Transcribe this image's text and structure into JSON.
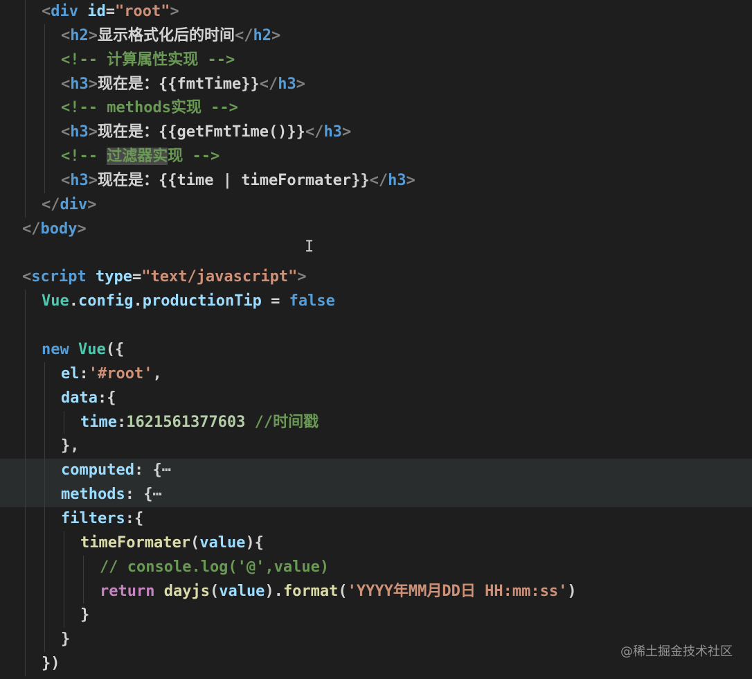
{
  "editor": {
    "colors": {
      "background": "#1e1e1e",
      "tag": "#569cd6",
      "attribute": "#9cdcfe",
      "string": "#ce9178",
      "comment": "#6a9955",
      "keyword": "#569cd6",
      "control": "#c586c0",
      "function": "#dcdcaa",
      "number": "#b5cea8",
      "text": "#d4d4d4"
    },
    "lines": [
      {
        "indent": 2,
        "guides": [
          1
        ],
        "tokens": [
          {
            "t": "<",
            "c": "#808080"
          },
          {
            "t": "div",
            "c": "#569cd6"
          },
          {
            "t": " id",
            "c": "#9cdcfe"
          },
          {
            "t": "=",
            "c": "#d4d4d4"
          },
          {
            "t": "\"root\"",
            "c": "#ce9178"
          },
          {
            "t": ">",
            "c": "#808080"
          }
        ]
      },
      {
        "indent": 3,
        "guides": [
          1,
          2
        ],
        "tokens": [
          {
            "t": "<",
            "c": "#808080"
          },
          {
            "t": "h2",
            "c": "#569cd6"
          },
          {
            "t": ">",
            "c": "#808080"
          },
          {
            "t": "显示格式化后的时间",
            "c": "#d4d4d4"
          },
          {
            "t": "</",
            "c": "#808080"
          },
          {
            "t": "h2",
            "c": "#569cd6"
          },
          {
            "t": ">",
            "c": "#808080"
          }
        ]
      },
      {
        "indent": 3,
        "guides": [
          1,
          2
        ],
        "tokens": [
          {
            "t": "<!-- 计算属性实现 -->",
            "c": "#6a9955"
          }
        ]
      },
      {
        "indent": 3,
        "guides": [
          1,
          2
        ],
        "tokens": [
          {
            "t": "<",
            "c": "#808080"
          },
          {
            "t": "h3",
            "c": "#569cd6"
          },
          {
            "t": ">",
            "c": "#808080"
          },
          {
            "t": "现在是：{{fmtTime}}",
            "c": "#d4d4d4"
          },
          {
            "t": "</",
            "c": "#808080"
          },
          {
            "t": "h3",
            "c": "#569cd6"
          },
          {
            "t": ">",
            "c": "#808080"
          }
        ]
      },
      {
        "indent": 3,
        "guides": [
          1,
          2
        ],
        "tokens": [
          {
            "t": "<!-- methods实现 -->",
            "c": "#6a9955"
          }
        ]
      },
      {
        "indent": 3,
        "guides": [
          1,
          2
        ],
        "tokens": [
          {
            "t": "<",
            "c": "#808080"
          },
          {
            "t": "h3",
            "c": "#569cd6"
          },
          {
            "t": ">",
            "c": "#808080"
          },
          {
            "t": "现在是：{{getFmtTime()}}",
            "c": "#d4d4d4"
          },
          {
            "t": "</",
            "c": "#808080"
          },
          {
            "t": "h3",
            "c": "#569cd6"
          },
          {
            "t": ">",
            "c": "#808080"
          }
        ]
      },
      {
        "indent": 3,
        "guides": [
          1,
          2
        ],
        "tokens": [
          {
            "t": "<!-- ",
            "c": "#6a9955"
          },
          {
            "t": "过滤器实",
            "c": "#6a9955",
            "sel": true
          },
          {
            "t": "现 -->",
            "c": "#6a9955"
          }
        ]
      },
      {
        "indent": 3,
        "guides": [
          1,
          2
        ],
        "tokens": [
          {
            "t": "<",
            "c": "#808080"
          },
          {
            "t": "h3",
            "c": "#569cd6"
          },
          {
            "t": ">",
            "c": "#808080"
          },
          {
            "t": "现在是：{{time | timeFormater}}",
            "c": "#d4d4d4"
          },
          {
            "t": "</",
            "c": "#808080"
          },
          {
            "t": "h3",
            "c": "#569cd6"
          },
          {
            "t": ">",
            "c": "#808080"
          }
        ]
      },
      {
        "indent": 2,
        "guides": [
          1
        ],
        "tokens": [
          {
            "t": "</",
            "c": "#808080"
          },
          {
            "t": "div",
            "c": "#569cd6"
          },
          {
            "t": ">",
            "c": "#808080"
          }
        ]
      },
      {
        "indent": 1,
        "guides": [],
        "tokens": [
          {
            "t": "</",
            "c": "#808080"
          },
          {
            "t": "body",
            "c": "#569cd6"
          },
          {
            "t": ">",
            "c": "#808080"
          }
        ]
      },
      {
        "indent": 0,
        "guides": [],
        "tokens": []
      },
      {
        "indent": 1,
        "guides": [],
        "tokens": [
          {
            "t": "<",
            "c": "#808080"
          },
          {
            "t": "script",
            "c": "#569cd6"
          },
          {
            "t": " type",
            "c": "#9cdcfe"
          },
          {
            "t": "=",
            "c": "#d4d4d4"
          },
          {
            "t": "\"text/javascript\"",
            "c": "#ce9178"
          },
          {
            "t": ">",
            "c": "#808080"
          }
        ]
      },
      {
        "indent": 2,
        "guides": [
          1
        ],
        "tokens": [
          {
            "t": "Vue",
            "c": "#4ec9b0"
          },
          {
            "t": ".",
            "c": "#d4d4d4"
          },
          {
            "t": "config",
            "c": "#9cdcfe"
          },
          {
            "t": ".",
            "c": "#d4d4d4"
          },
          {
            "t": "productionTip",
            "c": "#9cdcfe"
          },
          {
            "t": " = ",
            "c": "#d4d4d4"
          },
          {
            "t": "false",
            "c": "#569cd6"
          }
        ]
      },
      {
        "indent": 0,
        "guides": [
          1
        ],
        "tokens": []
      },
      {
        "indent": 2,
        "guides": [
          1
        ],
        "tokens": [
          {
            "t": "new ",
            "c": "#569cd6"
          },
          {
            "t": "Vue",
            "c": "#4ec9b0"
          },
          {
            "t": "({",
            "c": "#d4d4d4"
          }
        ]
      },
      {
        "indent": 3,
        "guides": [
          1,
          2
        ],
        "tokens": [
          {
            "t": "el",
            "c": "#9cdcfe"
          },
          {
            "t": ":",
            "c": "#d4d4d4"
          },
          {
            "t": "'#root'",
            "c": "#ce9178"
          },
          {
            "t": ",",
            "c": "#d4d4d4"
          }
        ]
      },
      {
        "indent": 3,
        "guides": [
          1,
          2
        ],
        "tokens": [
          {
            "t": "data",
            "c": "#9cdcfe"
          },
          {
            "t": ":{",
            "c": "#d4d4d4"
          }
        ]
      },
      {
        "indent": 4,
        "guides": [
          1,
          2,
          3
        ],
        "tokens": [
          {
            "t": "time",
            "c": "#9cdcfe"
          },
          {
            "t": ":",
            "c": "#d4d4d4"
          },
          {
            "t": "1621561377603",
            "c": "#b5cea8"
          },
          {
            "t": " //时间戳",
            "c": "#6a9955"
          }
        ]
      },
      {
        "indent": 3,
        "guides": [
          1,
          2
        ],
        "tokens": [
          {
            "t": "},",
            "c": "#d4d4d4"
          }
        ]
      },
      {
        "indent": 3,
        "guides": [
          1,
          2
        ],
        "hl": true,
        "tokens": [
          {
            "t": "computed",
            "c": "#9cdcfe"
          },
          {
            "t": ": {",
            "c": "#d4d4d4"
          },
          {
            "t": "⋯",
            "c": "#c5c5c5"
          }
        ]
      },
      {
        "indent": 3,
        "guides": [
          1,
          2
        ],
        "hl": true,
        "tokens": [
          {
            "t": "methods",
            "c": "#9cdcfe"
          },
          {
            "t": ": {",
            "c": "#d4d4d4"
          },
          {
            "t": "⋯",
            "c": "#c5c5c5"
          }
        ]
      },
      {
        "indent": 3,
        "guides": [
          1,
          2
        ],
        "tokens": [
          {
            "t": "filters",
            "c": "#9cdcfe"
          },
          {
            "t": ":{",
            "c": "#d4d4d4"
          }
        ]
      },
      {
        "indent": 4,
        "guides": [
          1,
          2,
          3
        ],
        "tokens": [
          {
            "t": "timeFormater",
            "c": "#dcdcaa"
          },
          {
            "t": "(",
            "c": "#d4d4d4"
          },
          {
            "t": "value",
            "c": "#9cdcfe"
          },
          {
            "t": "){",
            "c": "#d4d4d4"
          }
        ]
      },
      {
        "indent": 5,
        "guides": [
          1,
          2,
          3,
          4
        ],
        "tokens": [
          {
            "t": "// console.log('@',value)",
            "c": "#6a9955"
          }
        ]
      },
      {
        "indent": 5,
        "guides": [
          1,
          2,
          3,
          4
        ],
        "tokens": [
          {
            "t": "return ",
            "c": "#c586c0"
          },
          {
            "t": "dayjs",
            "c": "#dcdcaa"
          },
          {
            "t": "(",
            "c": "#d4d4d4"
          },
          {
            "t": "value",
            "c": "#9cdcfe"
          },
          {
            "t": ").",
            "c": "#d4d4d4"
          },
          {
            "t": "format",
            "c": "#dcdcaa"
          },
          {
            "t": "(",
            "c": "#d4d4d4"
          },
          {
            "t": "'YYYY年MM月DD日 HH:mm:ss'",
            "c": "#ce9178"
          },
          {
            "t": ")",
            "c": "#d4d4d4"
          }
        ]
      },
      {
        "indent": 4,
        "guides": [
          1,
          2,
          3
        ],
        "tokens": [
          {
            "t": "}",
            "c": "#d4d4d4"
          }
        ]
      },
      {
        "indent": 3,
        "guides": [
          1,
          2
        ],
        "tokens": [
          {
            "t": "}",
            "c": "#d4d4d4"
          }
        ]
      },
      {
        "indent": 2,
        "guides": [
          1
        ],
        "tokens": [
          {
            "t": "})",
            "c": "#d4d4d4"
          }
        ]
      }
    ]
  },
  "cursor_glyph": "I",
  "watermark": "@稀土掘金技术社区"
}
